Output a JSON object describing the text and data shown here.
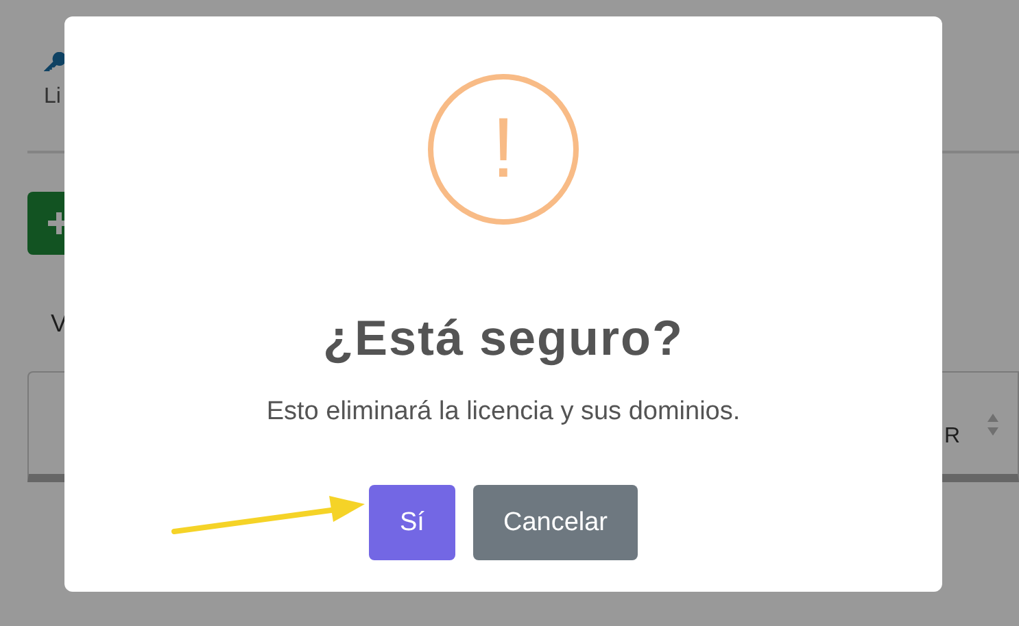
{
  "page": {
    "tab_label": "Li",
    "add_button": {
      "kind": "plus"
    },
    "filter_label": "V",
    "table": {
      "columns": [
        {
          "label": "R",
          "sortable": true
        }
      ]
    }
  },
  "dialog": {
    "icon": "!",
    "title": "¿Está seguro?",
    "message": "Esto eliminará la licencia y sus dominios.",
    "buttons": [
      {
        "label": "Sí",
        "kind": "confirm"
      },
      {
        "label": "Cancelar",
        "kind": "cancel"
      }
    ]
  },
  "annotation": {
    "kind": "arrow",
    "color": "#f5d327"
  }
}
